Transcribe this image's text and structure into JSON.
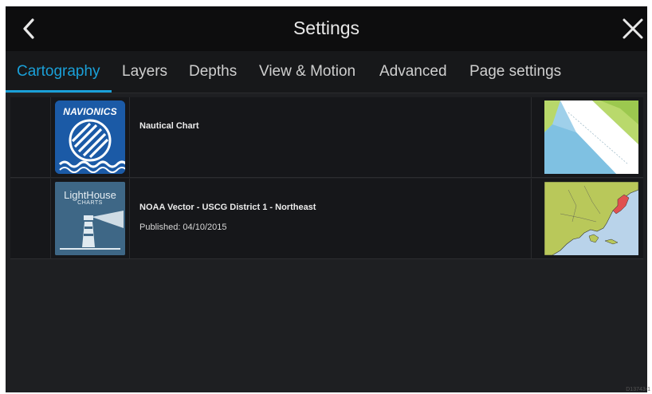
{
  "header": {
    "title": "Settings",
    "back_icon": "chevron-left-icon",
    "close_icon": "close-icon"
  },
  "tabs": [
    {
      "label": "Cartography",
      "active": true
    },
    {
      "label": "Layers",
      "active": false
    },
    {
      "label": "Depths",
      "active": false
    },
    {
      "label": "View & Motion",
      "active": false
    },
    {
      "label": "Advanced",
      "active": false
    },
    {
      "label": "Page settings",
      "active": false
    }
  ],
  "charts": [
    {
      "name": "Nautical Chart",
      "published": "",
      "logo": {
        "brand": "NAVIONICS"
      },
      "thumbnail": "nautical-chart-preview"
    },
    {
      "name": "NOAA Vector - USCG District 1 - Northeast",
      "published": "Published: 04/10/2015",
      "logo": {
        "brand": "LightHouse",
        "sub": "CHARTS"
      },
      "thumbnail": "north-america-map-preview"
    }
  ],
  "colors": {
    "accent": "#1aa0d8",
    "background": "#1e1f22",
    "titlebar": "#0d0d0e"
  },
  "figure_code": "D13743-1"
}
